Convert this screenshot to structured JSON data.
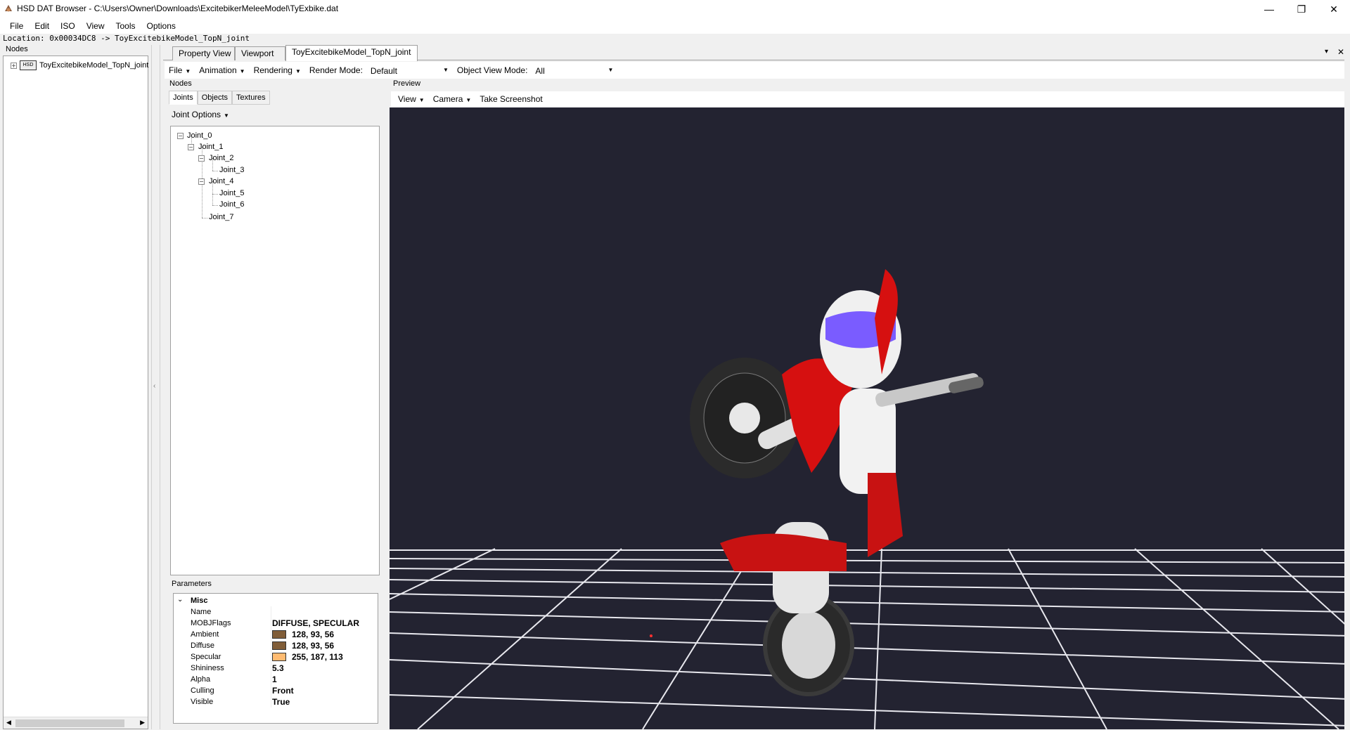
{
  "window": {
    "title": "HSD DAT Browser - C:\\Users\\Owner\\Downloads\\ExcitebikerMeleeModel\\TyExbike.dat",
    "minimize_glyph": "—",
    "restore_glyph": "❐",
    "close_glyph": "✕"
  },
  "menu": [
    "File",
    "Edit",
    "ISO",
    "View",
    "Tools",
    "Options"
  ],
  "location": "Location: 0x00034DC8 -> ToyExcitebikeModel_TopN_joint",
  "left_panel": {
    "label": "Nodes",
    "root_node": "ToyExcitebikeModel_TopN_joint",
    "expand_glyph": "+",
    "icon_text": "HSD"
  },
  "tabs": [
    {
      "label": "Property View",
      "active": false
    },
    {
      "label": "Viewport",
      "active": false
    },
    {
      "label": "ToyExcitebikeModel_TopN_joint",
      "active": true
    }
  ],
  "tab_controls": {
    "dropdown_glyph": "▾",
    "close_glyph": "✕"
  },
  "doc_toolbar": {
    "file": "File",
    "animation": "Animation",
    "rendering": "Rendering",
    "render_mode_label": "Render Mode:",
    "render_mode_value": "Default",
    "object_view_mode_label": "Object View Mode:",
    "object_view_mode_value": "All"
  },
  "nodes_panel": {
    "label": "Nodes",
    "subtabs": [
      "Joints",
      "Objects",
      "Textures"
    ],
    "joint_options": "Joint Options",
    "joints": [
      "Joint_0",
      "Joint_1",
      "Joint_2",
      "Joint_3",
      "Joint_4",
      "Joint_5",
      "Joint_6",
      "Joint_7"
    ]
  },
  "parameters": {
    "label": "Parameters",
    "section": "Misc",
    "rows": [
      {
        "name": "Name",
        "value": ""
      },
      {
        "name": "MOBJFlags",
        "value": "DIFFUSE, SPECULAR"
      },
      {
        "name": "Ambient",
        "value": "128, 93, 56",
        "color": "#805d38"
      },
      {
        "name": "Diffuse",
        "value": "128, 93, 56",
        "color": "#805d38"
      },
      {
        "name": "Specular",
        "value": "255, 187, 113",
        "color": "#ffbb71"
      },
      {
        "name": "Shininess",
        "value": "5.3"
      },
      {
        "name": "Alpha",
        "value": "1"
      },
      {
        "name": "Culling",
        "value": "Front"
      },
      {
        "name": "Visible",
        "value": "True"
      }
    ]
  },
  "preview": {
    "label": "Preview",
    "toolbar": {
      "view": "View",
      "camera": "Camera",
      "screenshot": "Take Screenshot"
    },
    "background": "#232331"
  }
}
